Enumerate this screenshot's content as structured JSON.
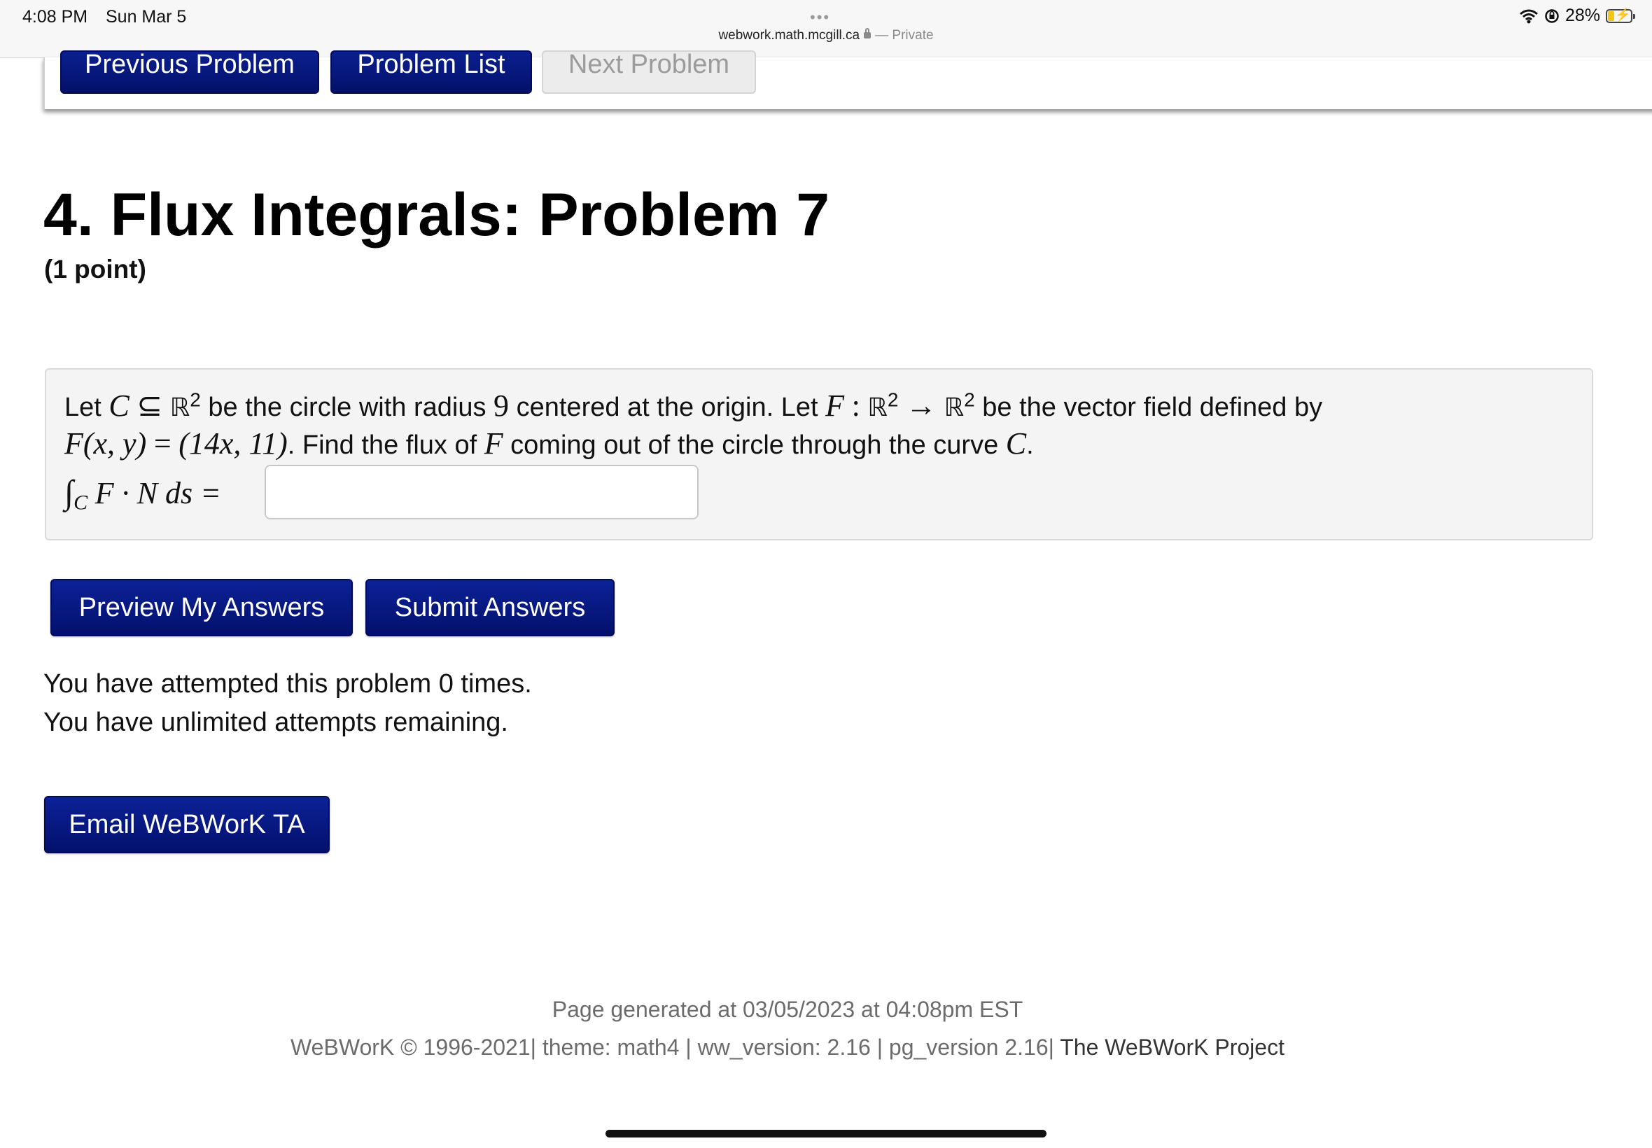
{
  "status_bar": {
    "time": "4:08 PM",
    "date": "Sun Mar 5",
    "dots": "•••",
    "url": "webwork.math.mcgill.ca",
    "private_label": "— Private",
    "battery": "28%",
    "battery_level": 0.28
  },
  "nav": {
    "previous": "Previous Problem",
    "list": "Problem List",
    "next": "Next Problem"
  },
  "problem": {
    "title": "4. Flux Integrals: Problem 7",
    "points": "(1 point)",
    "text": {
      "let": "Let",
      "c": "C",
      "subseteq": "⊆",
      "r2": "ℝ",
      "two": "2",
      "seg1": "be the circle with radius",
      "radius": "9",
      "seg2": "centered at the origin. Let",
      "f": "F",
      "colon": ":",
      "arrow": "→",
      "seg3": "be the vector field defined by",
      "fxy": "F(x, y)",
      "eq": "=",
      "field": "(14x, 11)",
      "seg4": ". Find the flux of",
      "seg5": "coming out of the circle through the curve",
      "dot": ".",
      "integral": "∫",
      "sub_c": "C",
      "integrand": "F · N ds =",
      "answer_value": ""
    }
  },
  "actions": {
    "preview": "Preview My Answers",
    "submit": "Submit Answers",
    "email": "Email WeBWorK TA"
  },
  "attempts": {
    "line1": "You have attempted this problem 0 times.",
    "line2": "You have unlimited attempts remaining."
  },
  "footer": {
    "generated": "Page generated at 03/05/2023 at 04:08pm EST",
    "copyright": "WeBWorK © 1996-2021| theme: math4 | ww_version: 2.16 | pg_version 2.16|",
    "project": "The WeBWorK Project"
  }
}
